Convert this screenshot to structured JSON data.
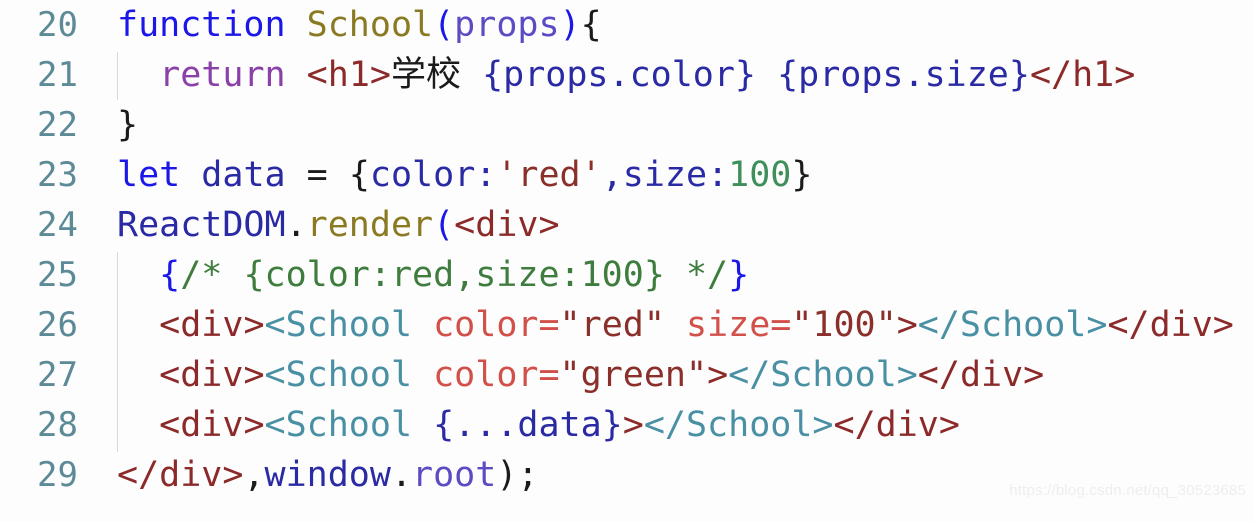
{
  "editor": {
    "background_color": "#fdfdfd",
    "gutter_color": "#5c8a97",
    "indent_guide_color": "#d8d8d8"
  },
  "lines": [
    {
      "number": "20",
      "text": "function School(props){"
    },
    {
      "number": "21",
      "text": "  return <h1>学校 {props.color} {props.size}</h1>"
    },
    {
      "number": "22",
      "text": "}"
    },
    {
      "number": "23",
      "text": "let data = {color:'red',size:100}"
    },
    {
      "number": "24",
      "text": "ReactDOM.render(<div>"
    },
    {
      "number": "25",
      "text": "  {/* {color:red,size:100} */}"
    },
    {
      "number": "26",
      "text": "  <div><School color=\"red\" size=\"100\"></School></div>"
    },
    {
      "number": "27",
      "text": "  <div><School color=\"green\"></School></div>"
    },
    {
      "number": "28",
      "text": "  <div><School {...data}></School></div>"
    },
    {
      "number": "29",
      "text": "</div>,window.root);"
    }
  ],
  "tokens": {
    "l20": {
      "kw_function": "function",
      "space1": " ",
      "fn_name": "School",
      "paren_open": "(",
      "param": "props",
      "paren_close": ")",
      "brace_open": "{"
    },
    "l21": {
      "indent": "  ",
      "kw_return": "return",
      "space": " ",
      "tag_open": "<h1>",
      "text_cjk": "学校",
      "space2": " ",
      "expr1": "{props.color}",
      "space3": " ",
      "expr2": "{props.size}",
      "tag_close": "</h1>"
    },
    "l22": {
      "brace_close": "}"
    },
    "l23": {
      "kw_let": "let",
      "space1": " ",
      "ident": "data",
      "space2": " ",
      "equals": "=",
      "space3": " ",
      "brace_open": "{",
      "key_color": "color:",
      "str_red": "'red'",
      "comma": ",",
      "key_size": "size:",
      "num_100": "100",
      "brace_close": "}"
    },
    "l24": {
      "obj": "ReactDOM",
      "dot": ".",
      "method": "render",
      "paren": "(",
      "tag": "<div>"
    },
    "l25": {
      "indent": "  ",
      "brace_open": "{",
      "comment": "/* {color:red,size:100} */",
      "brace_close": "}"
    },
    "l26": {
      "indent": "  ",
      "div_open": "<div>",
      "comp_open": "<School",
      "space1": " ",
      "attr_color": "color=",
      "val_red": "\"red\"",
      "space2": " ",
      "attr_size": "size=",
      "val_100": "\"100\"",
      "gt": ">",
      "comp_close": "</School>",
      "div_close": "</div>"
    },
    "l27": {
      "indent": "  ",
      "div_open": "<div>",
      "comp_open": "<School",
      "space1": " ",
      "attr_color": "color=",
      "val_green": "\"green\"",
      "gt": ">",
      "comp_close": "</School>",
      "div_close": "</div>"
    },
    "l28": {
      "indent": "  ",
      "div_open": "<div>",
      "comp_open": "<School",
      "space1": " ",
      "spread": "{...data}",
      "gt": ">",
      "comp_close": "</School>",
      "div_close": "</div>"
    },
    "l29": {
      "div_close": "</div>",
      "comma": ",",
      "obj": "window",
      "dot": ".",
      "prop": "root",
      "paren_semi": ");"
    }
  },
  "watermark": {
    "text": "https://blog.csdn.net/qq_30523685"
  }
}
